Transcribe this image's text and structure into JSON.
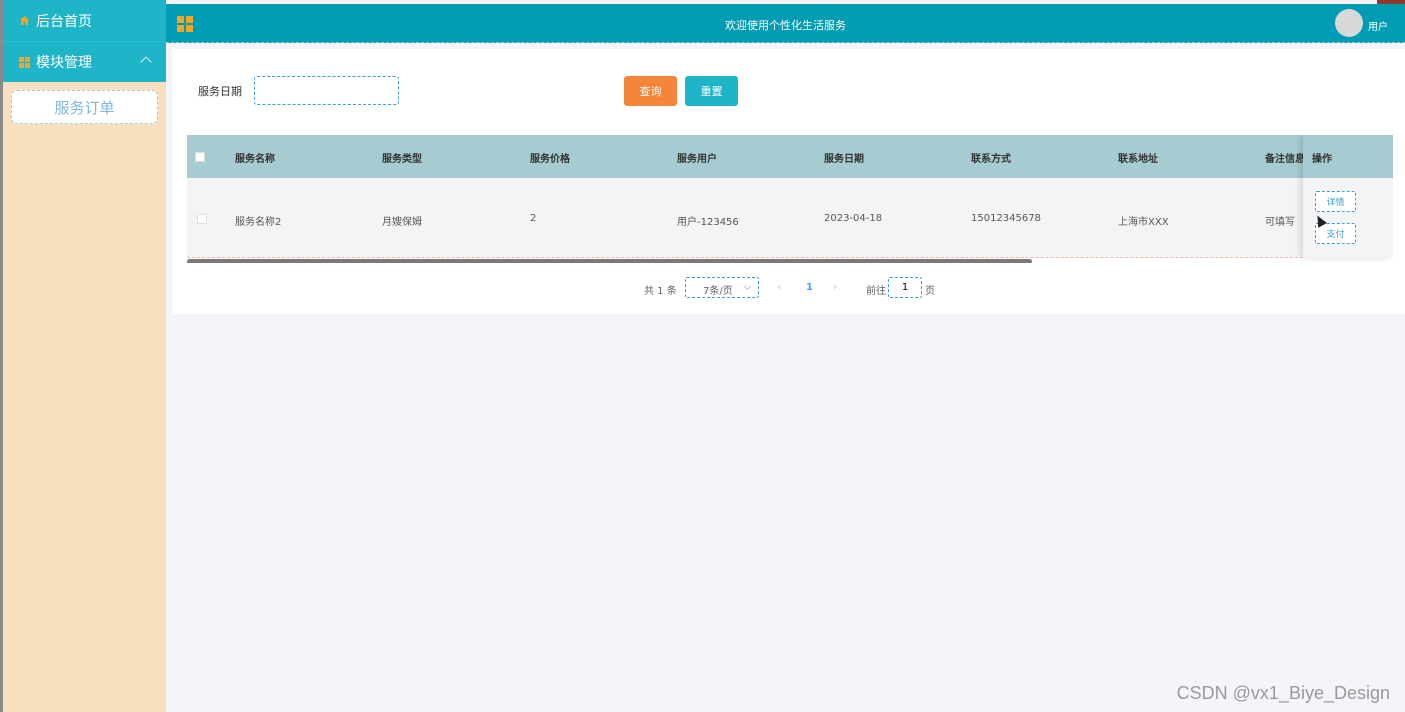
{
  "sidebar": {
    "items": [
      {
        "label": "后台首页",
        "icon": "home-icon"
      },
      {
        "label": "模块管理",
        "icon": "grid-icon"
      }
    ],
    "submenu": [
      {
        "label": "服务订单"
      }
    ]
  },
  "header": {
    "title": "欢迎使用个性化生活服务",
    "user_label": "用户"
  },
  "search": {
    "label": "服务日期",
    "value": "",
    "query_label": "查询",
    "reset_label": "重置"
  },
  "table": {
    "columns": [
      "服务名称",
      "服务类型",
      "服务价格",
      "服务用户",
      "服务日期",
      "联系方式",
      "联系地址",
      "备注信息"
    ],
    "op_column": "操作",
    "rows": [
      {
        "cells": [
          "服务名称2",
          "月嫂保姆",
          "2",
          "用户-123456",
          "2023-04-18",
          "15012345678",
          "上海市XXX",
          "可填写"
        ],
        "detail_label": "详情",
        "pay_label": "支付"
      }
    ]
  },
  "pagination": {
    "total_text": "共 1 条",
    "page_size": "7条/页",
    "current_page": "1",
    "goto_label": "前往",
    "goto_value": "1",
    "page_suffix": "页"
  },
  "watermark": "CSDN @vx1_Biye_Design",
  "colors": {
    "accent": "#009cb4",
    "sidebar_bg": "#f8e0bf",
    "query_button": "#f5853a",
    "reset_button": "#1fb5c9",
    "table_header": "#a6cbd0"
  }
}
